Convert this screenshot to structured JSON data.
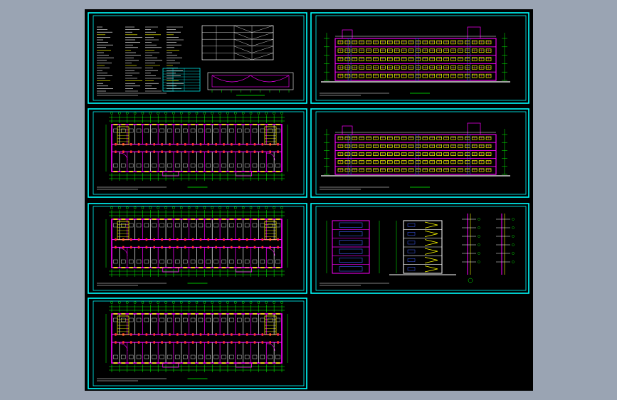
{
  "viewer": {
    "background": "#9aa4b3",
    "canvas_color": "#000000"
  },
  "colors": {
    "frame": "#00ffff",
    "line_green": "#00ff00",
    "line_magenta": "#ff00ff",
    "line_yellow": "#ffff00",
    "line_red": "#ff3333",
    "line_white": "#ffffff",
    "line_blue": "#4060ff"
  },
  "sheets": [
    {
      "id": "general-notes",
      "kind": "notes"
    },
    {
      "id": "elevation-front",
      "kind": "elevation"
    },
    {
      "id": "floor-plan-1",
      "kind": "plan"
    },
    {
      "id": "elevation-rear",
      "kind": "elevation"
    },
    {
      "id": "floor-plan-2",
      "kind": "plan"
    },
    {
      "id": "sections-details",
      "kind": "section"
    },
    {
      "id": "floor-plan-3",
      "kind": "plan"
    }
  ]
}
